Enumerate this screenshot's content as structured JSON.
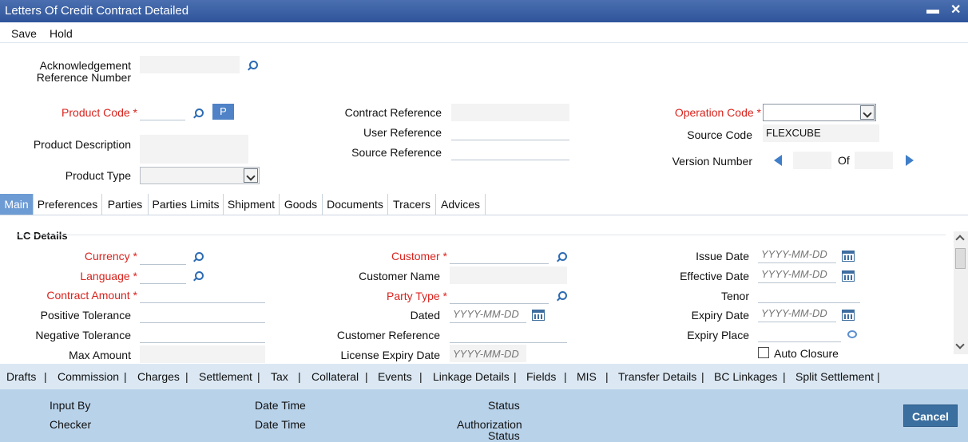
{
  "window": {
    "title": "Letters Of Credit Contract Detailed",
    "minimize": "▬",
    "close": "✕"
  },
  "menu": {
    "save": "Save",
    "hold": "Hold"
  },
  "header": {
    "ack_ref_label_1": "Acknowledgement",
    "ack_ref_label_2": "Reference Number",
    "product_code_label": "Product Code",
    "required_mark": "*",
    "p_button": "P",
    "product_description_label": "Product Description",
    "product_type_label": "Product Type",
    "contract_reference_label": "Contract Reference",
    "user_reference_label": "User Reference",
    "source_reference_label": "Source Reference",
    "operation_code_label": "Operation Code",
    "source_code_label": "Source Code",
    "source_code_value": "FLEXCUBE",
    "version_number_label": "Version Number",
    "of_label": "Of"
  },
  "tabs": [
    "Main",
    "Preferences",
    "Parties",
    "Parties Limits",
    "Shipment",
    "Goods",
    "Documents",
    "Tracers",
    "Advices"
  ],
  "lc_details": {
    "section_title": "LC Details",
    "currency_label": "Currency",
    "language_label": "Language",
    "contract_amount_label": "Contract Amount",
    "positive_tolerance_label": "Positive Tolerance",
    "negative_tolerance_label": "Negative Tolerance",
    "max_amount_label": "Max Amount",
    "customer_label": "Customer",
    "customer_name_label": "Customer Name",
    "party_type_label": "Party Type",
    "dated_label": "Dated",
    "customer_reference_label": "Customer Reference",
    "license_expiry_label": "License Expiry Date",
    "issue_date_label": "Issue Date",
    "effective_date_label": "Effective Date",
    "tenor_label": "Tenor",
    "expiry_date_label": "Expiry Date",
    "expiry_place_label": "Expiry Place",
    "auto_closure_label": "Auto Closure",
    "date_placeholder": "YYYY-MM-DD"
  },
  "bottom_links": [
    "Drafts",
    "Commission",
    "Charges",
    "Settlement",
    "Tax",
    "Collateral",
    "Events",
    "Linkage Details",
    "Fields",
    "MIS",
    "Transfer Details",
    "BC Linkages",
    "Split Settlement"
  ],
  "bottom_separator": "|",
  "footer": {
    "input_by": "Input By",
    "checker": "Checker",
    "date_time_1": "Date Time",
    "date_time_2": "Date Time",
    "status": "Status",
    "authorization_status_1": "Authorization",
    "authorization_status_2": "Status",
    "cancel": "Cancel"
  },
  "colors": {
    "title_bar": "#3a5fa3",
    "required": "#d9231d",
    "active_tab": "#6d9bd4",
    "footer": "#b8d2ea",
    "bottom_bar": "#dbe8f3"
  }
}
